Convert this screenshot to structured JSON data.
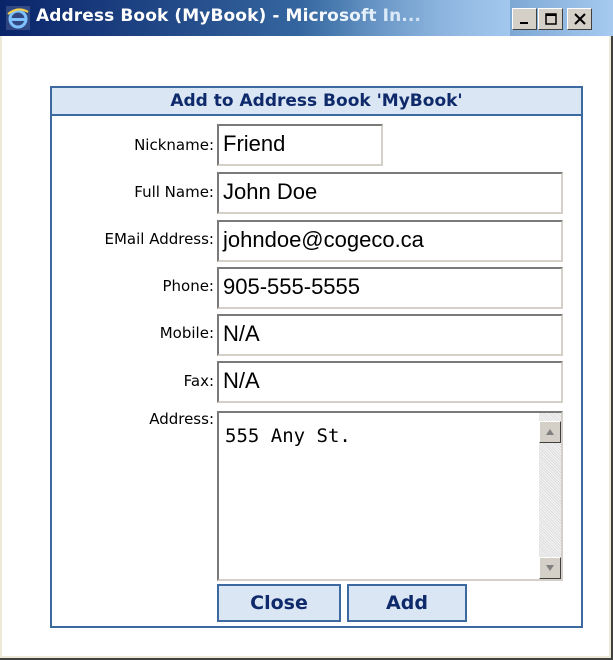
{
  "window": {
    "title": "Address Book (MyBook) - Microsoft In...",
    "app_icon": "internet-explorer-icon",
    "buttons": [
      "minimize-icon",
      "maximize-icon",
      "close-icon"
    ]
  },
  "form": {
    "header": "Add to Address Book 'MyBook'",
    "fields": {
      "nickname": {
        "label": "Nickname:",
        "value": "Friend"
      },
      "full_name": {
        "label": "Full Name:",
        "value": "John Doe"
      },
      "email": {
        "label": "EMail Address:",
        "value": "johndoe@cogeco.ca"
      },
      "phone": {
        "label": "Phone:",
        "value": "905-555-5555"
      },
      "mobile": {
        "label": "Mobile:",
        "value": "N/A"
      },
      "fax": {
        "label": "Fax:",
        "value": "N/A"
      },
      "address": {
        "label": "Address:",
        "value": "555 Any St."
      }
    },
    "buttons": {
      "close": "Close",
      "add": "Add"
    }
  },
  "colors": {
    "accent": "#3c6aa0",
    "header_bg": "#dbe6f4",
    "header_text": "#0e2a6b"
  }
}
